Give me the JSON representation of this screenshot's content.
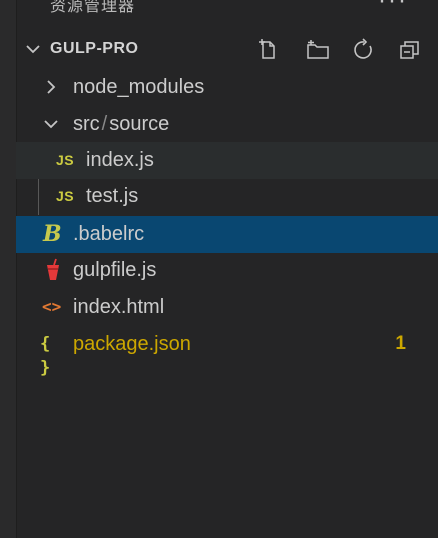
{
  "header": {
    "title": "资源管理器",
    "more_label": "···"
  },
  "section": {
    "project_name": "GULP-PRO",
    "actions": [
      {
        "name": "new-file-icon"
      },
      {
        "name": "new-folder-icon"
      },
      {
        "name": "refresh-icon"
      },
      {
        "name": "collapse-all-icon"
      }
    ]
  },
  "tree": {
    "node_modules": "node_modules",
    "src_folder": "src",
    "source_folder": "source",
    "index_js": "index.js",
    "test_js": "test.js",
    "babelrc": ".babelrc",
    "gulpfile": "gulpfile.js",
    "index_html": "index.html",
    "package_json": "package.json",
    "package_json_problems": "1",
    "js_icon_label": "JS",
    "html_icon_label": "<>",
    "json_icon_label": "{ }",
    "babel_icon_label": "B"
  },
  "colors": {
    "background": "#252526",
    "selection": "#094771",
    "js_icon": "#cbcb41",
    "html_icon": "#e37933",
    "gulp_icon": "#e5393a",
    "warning": "#cca700"
  }
}
